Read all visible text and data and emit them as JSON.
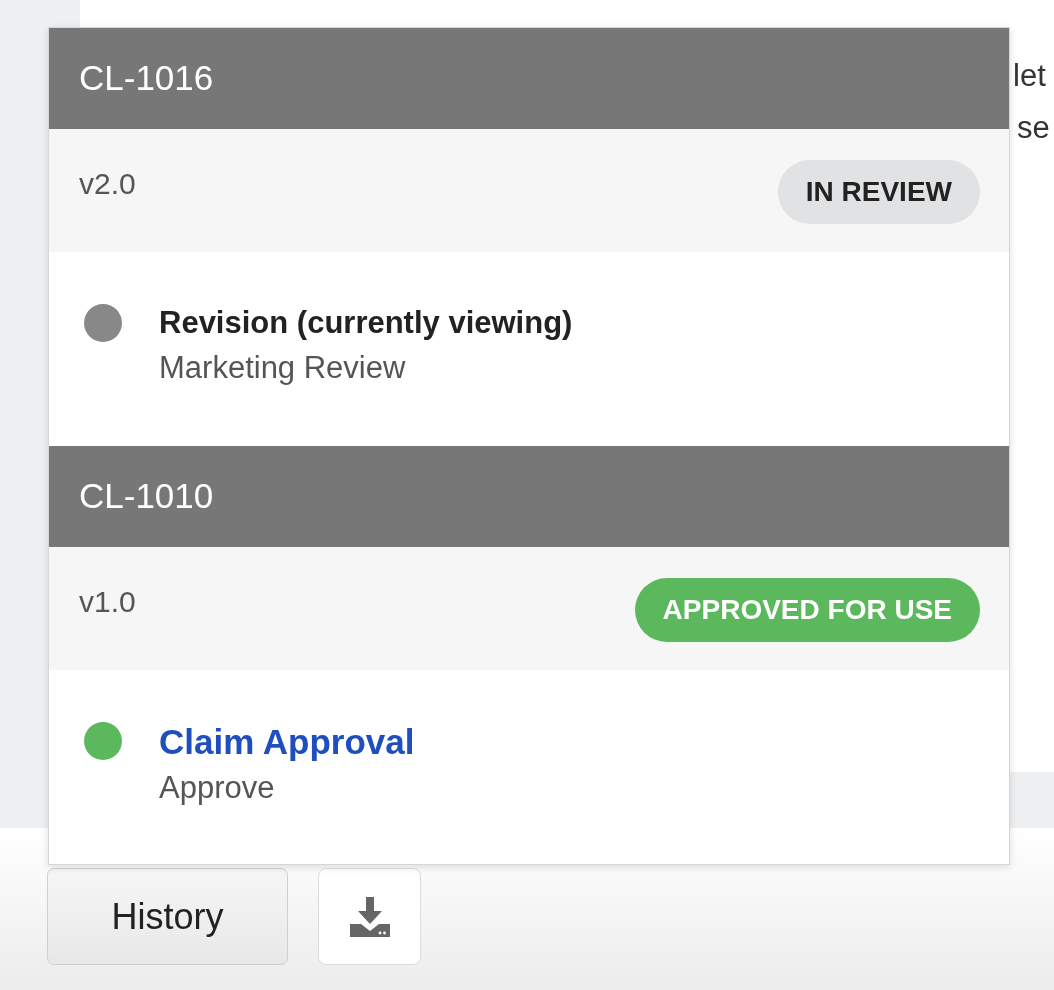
{
  "background_text": [
    "let",
    "se"
  ],
  "history": [
    {
      "id": "CL-1016",
      "version": "v2.0",
      "status": {
        "label": "IN REVIEW",
        "kind": "review"
      },
      "steps": [
        {
          "kind": "text",
          "title": "Revision (currently viewing)",
          "subtitle": "Marketing Review",
          "color": "#888888"
        }
      ]
    },
    {
      "id": "CL-1010",
      "version": "v1.0",
      "status": {
        "label": "APPROVED FOR USE",
        "kind": "approved"
      },
      "steps": [
        {
          "kind": "link",
          "title": "Claim Approval",
          "subtitle": "Approve",
          "color": "#5cb85c"
        }
      ]
    }
  ],
  "toolbar": {
    "history_button": "History"
  }
}
